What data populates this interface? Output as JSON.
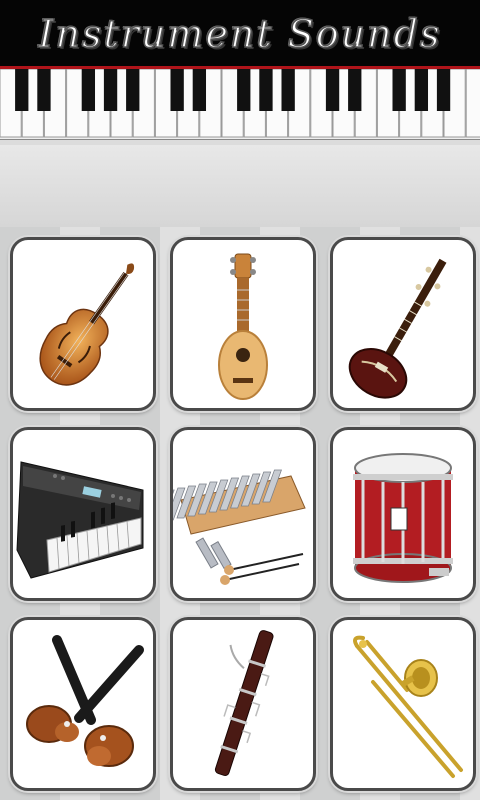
{
  "header": {
    "title": "Instrument Sounds"
  },
  "instruments": [
    {
      "icon": "double-bass-icon"
    },
    {
      "icon": "ukulele-icon"
    },
    {
      "icon": "sitar-icon"
    },
    {
      "icon": "electronic-keyboard-icon"
    },
    {
      "icon": "glockenspiel-icon"
    },
    {
      "icon": "snare-drum-icon"
    },
    {
      "icon": "castanets-icon"
    },
    {
      "icon": "bassoon-icon"
    },
    {
      "icon": "trombone-icon"
    }
  ]
}
